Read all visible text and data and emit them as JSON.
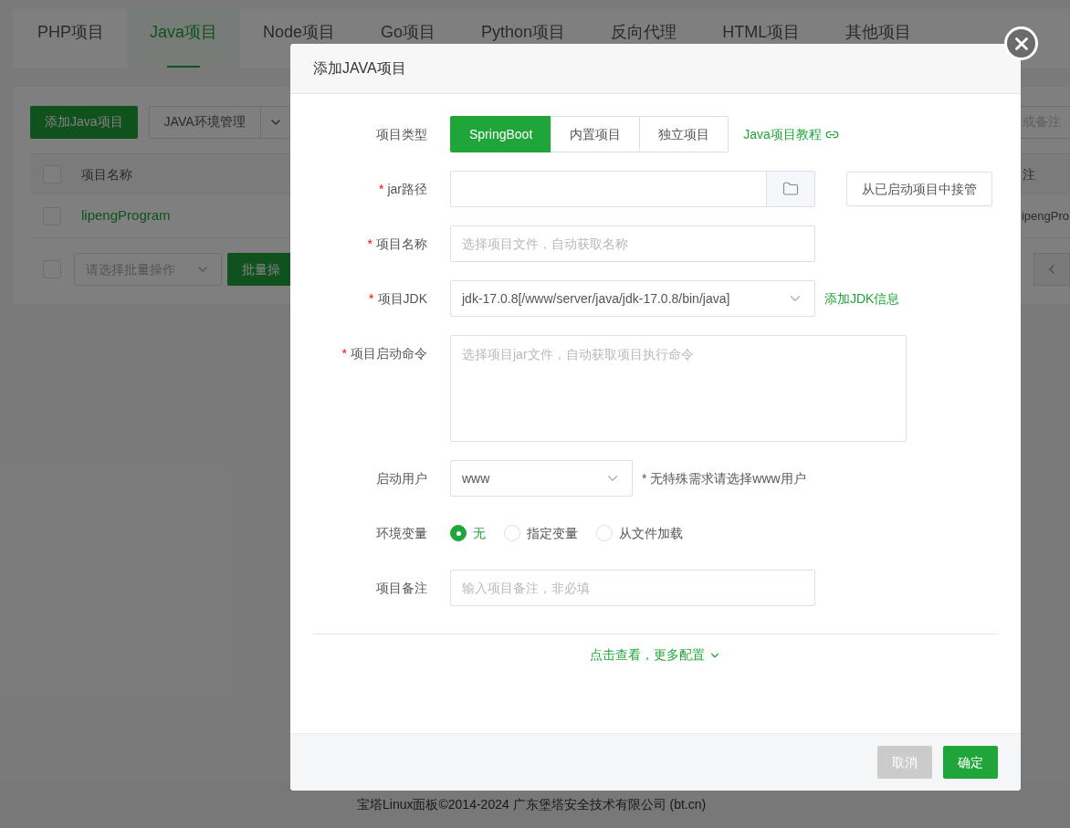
{
  "tabs": [
    {
      "label": "PHP项目",
      "selected": false
    },
    {
      "label": "Java项目",
      "selected": true
    },
    {
      "label": "Node项目",
      "selected": false
    },
    {
      "label": "Go项目",
      "selected": false
    },
    {
      "label": "Python项目",
      "selected": false
    },
    {
      "label": "反向代理",
      "selected": false
    },
    {
      "label": "HTML项目",
      "selected": false
    },
    {
      "label": "其他项目",
      "selected": false
    }
  ],
  "toolbar": {
    "add_button": "添加Java项目",
    "env_dropdown": "JAVA环境管理",
    "search_placeholder": "或备注"
  },
  "table": {
    "header_checked": false,
    "columns": [
      {
        "label": "项目名称"
      },
      {
        "label": "注"
      }
    ],
    "rows": [
      {
        "checked": false,
        "name": "lipengProgram",
        "column_2": "ipengPro"
      }
    ]
  },
  "batch": {
    "checked": false,
    "placeholder": "请选择批量操作",
    "button": "批量操"
  },
  "dialog": {
    "title": "添加JAVA项目",
    "required_mark": "*",
    "fields": [
      {
        "kind": "segmented",
        "label": "项目类型",
        "required": false,
        "options": [
          {
            "label": "SpringBoot",
            "selected": true
          },
          {
            "label": "内置项目",
            "selected": false
          },
          {
            "label": "独立项目",
            "selected": false
          }
        ],
        "link": "Java项目教程"
      },
      {
        "kind": "file",
        "label": "jar路径",
        "required": true,
        "side_button": "从已启动项目中接管"
      },
      {
        "kind": "text",
        "label": "项目名称",
        "required": true,
        "placeholder": "选择项目文件，自动获取名称"
      },
      {
        "kind": "select",
        "label": "项目JDK",
        "required": true,
        "value": "jdk-17.0.8[/www/server/java/jdk-17.0.8/bin/java]",
        "link": "添加JDK信息"
      },
      {
        "kind": "textarea",
        "label": "项目启动命令",
        "required": true,
        "placeholder": "选择项目jar文件，自动获取项目执行命令"
      },
      {
        "kind": "select-short",
        "label": "启动用户",
        "required": false,
        "value": "www",
        "hint": "* 无特殊需求请选择www用户"
      },
      {
        "kind": "radio",
        "label": "环境变量",
        "required": false,
        "options": [
          {
            "label": "无",
            "selected": true
          },
          {
            "label": "指定变量",
            "selected": false
          },
          {
            "label": "从文件加载",
            "selected": false
          }
        ]
      },
      {
        "kind": "text",
        "label": "项目备注",
        "required": false,
        "placeholder": "输入项目备注，非必填"
      }
    ],
    "more_link": "点击查看，更多配置",
    "buttons": [
      {
        "kind": "cancel",
        "label": "取消"
      },
      {
        "kind": "primary",
        "label": "确定"
      }
    ]
  },
  "footer": {
    "copyright": "宝塔Linux面板©2014-2024 广东堡塔安全技术有限公司 (bt.cn)"
  }
}
